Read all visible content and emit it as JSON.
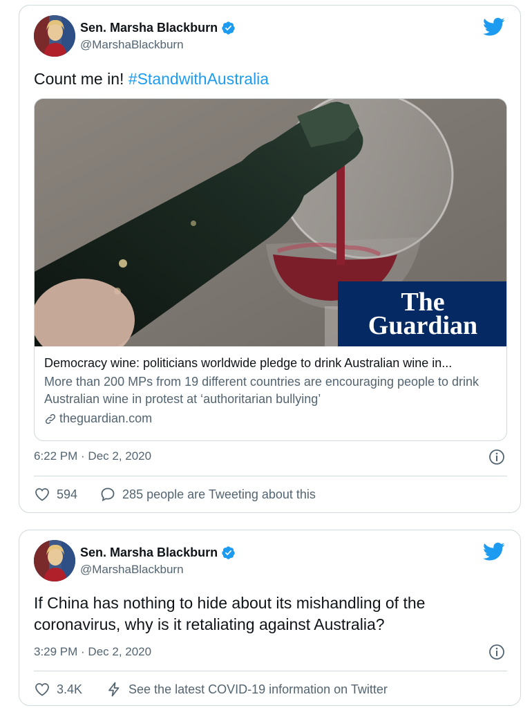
{
  "tweets": [
    {
      "author": {
        "name": "Sen. Marsha Blackburn",
        "handle": "@MarshaBlackburn",
        "verified": true
      },
      "text": "Count me in! ",
      "hashtag": "#StandwithAustralia",
      "card": {
        "logo_line1": "The",
        "logo_line2": "Guardian",
        "title": "Democracy wine: politicians worldwide pledge to drink Australian wine in...",
        "description": "More than 200 MPs from 19 different countries are encouraging people to drink Australian wine in protest at ‘authoritarian bullying’",
        "domain": "theguardian.com"
      },
      "timestamp": "6:22 PM · Dec 2, 2020",
      "likes": "594",
      "secondary_action": "285 people are Tweeting about this",
      "icons": {
        "like": "heart-icon",
        "secondary": "comment-icon",
        "info": "info-icon",
        "brand": "twitter-bird-icon"
      }
    },
    {
      "author": {
        "name": "Sen. Marsha Blackburn",
        "handle": "@MarshaBlackburn",
        "verified": true
      },
      "text": "If China has nothing to hide about its mishandling of the coronavirus, why is it retaliating against Australia?",
      "timestamp": "3:29 PM · Dec 2, 2020",
      "likes": "3.4K",
      "secondary_action": "See the latest COVID-19 information on Twitter",
      "icons": {
        "like": "heart-icon",
        "secondary": "lightning-icon",
        "info": "info-icon",
        "brand": "twitter-bird-icon"
      }
    }
  ],
  "colors": {
    "brand": "#1d9bf0",
    "muted": "#536471",
    "border": "#cfd9de",
    "guardian": "#052962"
  }
}
